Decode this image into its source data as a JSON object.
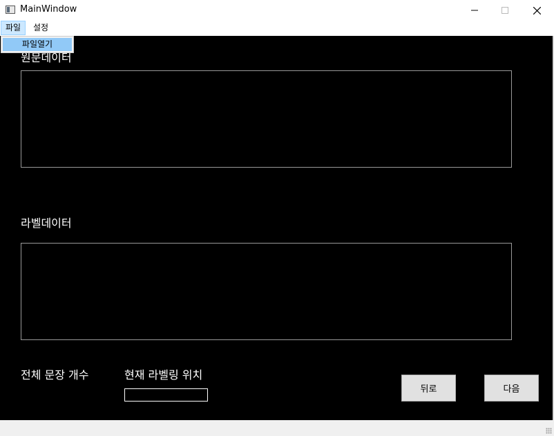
{
  "window": {
    "title": "MainWindow",
    "minimize_icon": "minimize-icon",
    "maximize_icon": "maximize-icon",
    "close_icon": "close-icon"
  },
  "menu": {
    "file_label": "파일",
    "settings_label": "설정",
    "file_dropdown": {
      "open_file_label": "파일열기"
    }
  },
  "main": {
    "source_data_label": "원문데이터",
    "label_data_label": "라벨데이터",
    "total_sentences_label": "전체 문장 개수",
    "current_position_label": "현재 라벨링 위치",
    "position_value": "",
    "back_button_label": "뒤로",
    "next_button_label": "다음"
  },
  "colors": {
    "background": "#000000",
    "menu_highlight": "#cce8ff",
    "dropdown_highlight": "#91c9f7",
    "button_face": "#e1e1e1"
  }
}
